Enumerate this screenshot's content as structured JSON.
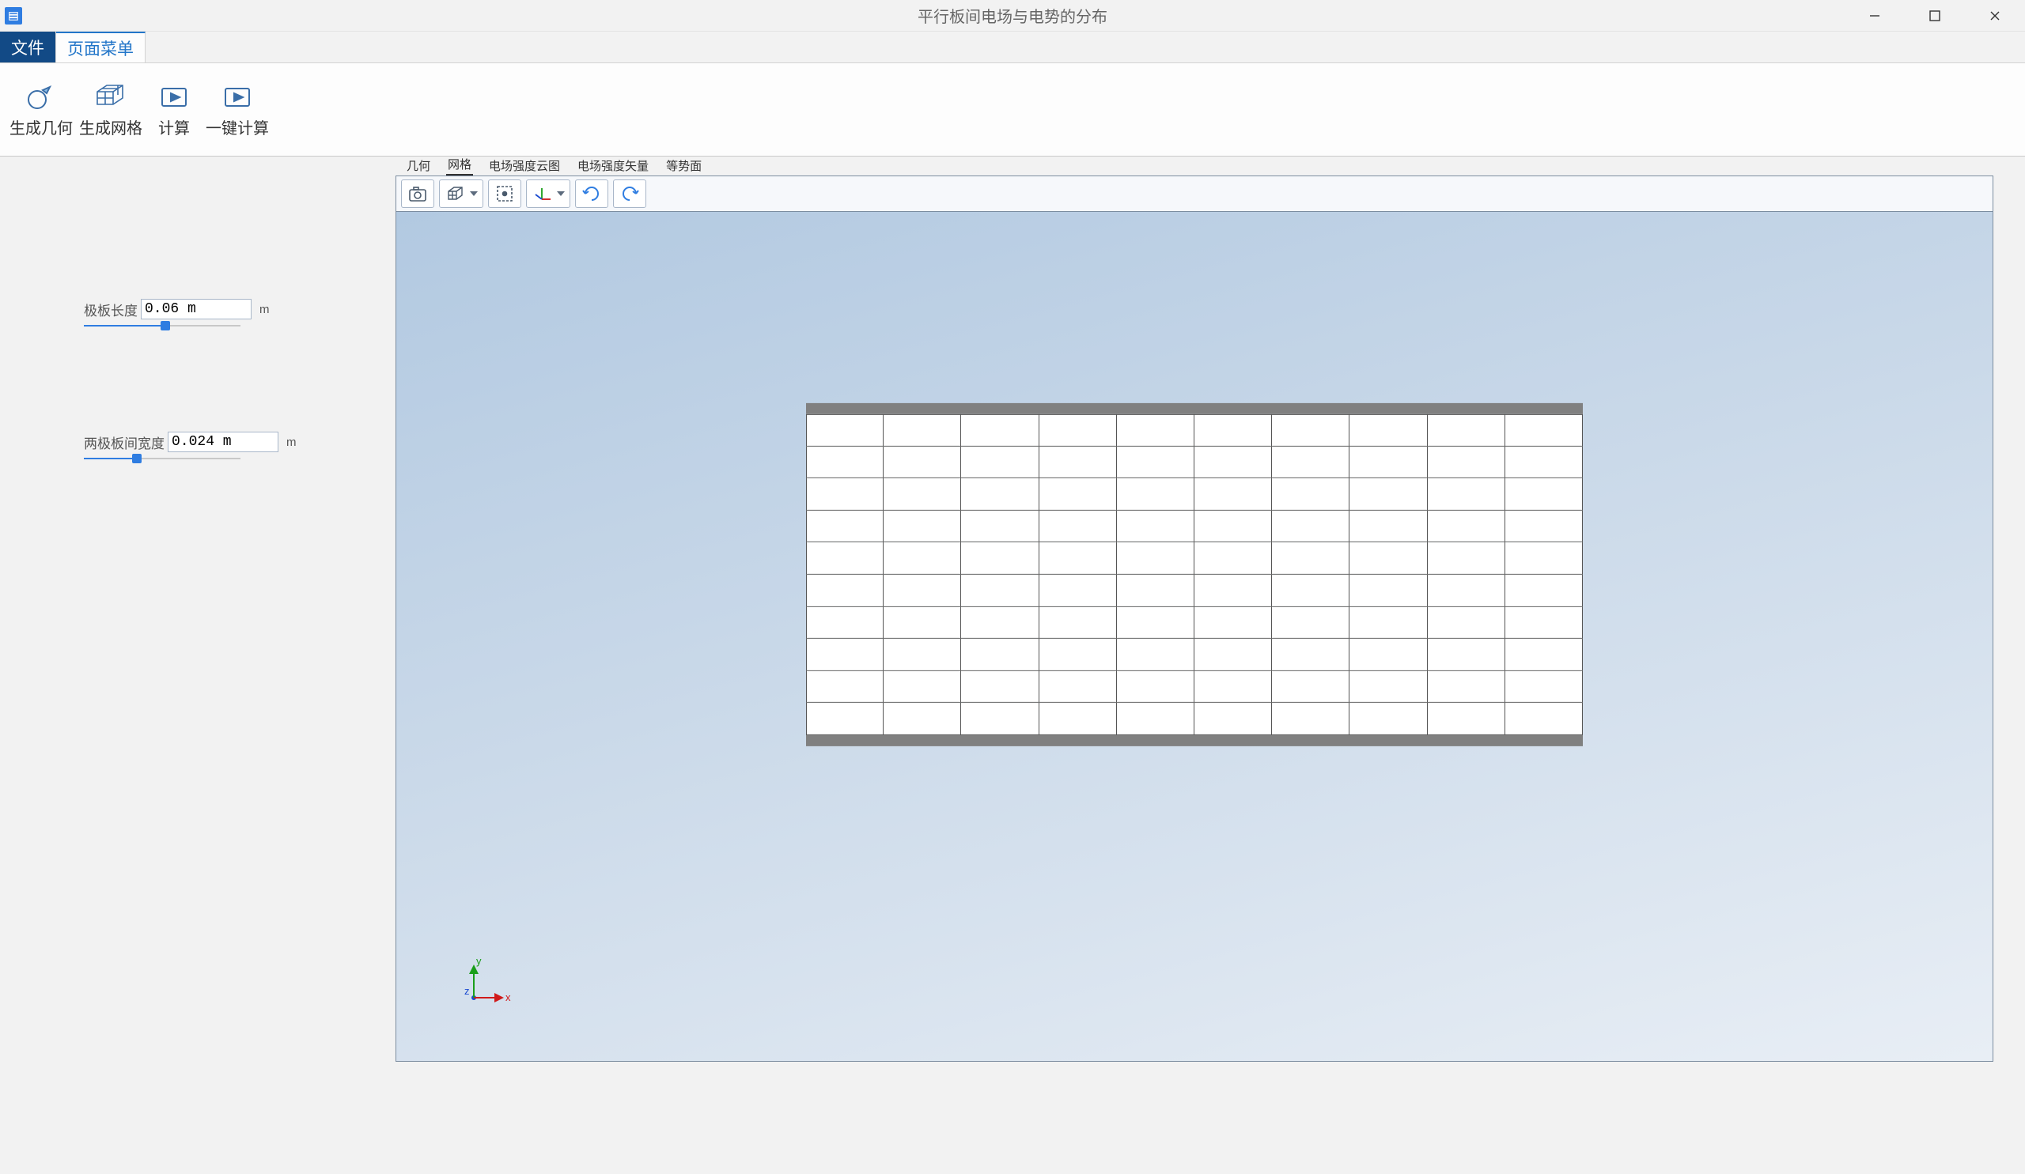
{
  "window": {
    "title": "平行板间电场与电势的分布"
  },
  "menu": {
    "tabs": [
      "文件",
      "页面菜单"
    ],
    "active_index": 1
  },
  "ribbon": {
    "buttons": [
      {
        "label": "生成几何",
        "icon": "generate-geometry-icon"
      },
      {
        "label": "生成网格",
        "icon": "generate-mesh-icon"
      },
      {
        "label": "计算",
        "icon": "compute-icon"
      },
      {
        "label": "一键计算",
        "icon": "compute-all-icon"
      }
    ]
  },
  "params": {
    "plate_length": {
      "label": "极板长度",
      "value": "0.06 m",
      "unit": "m",
      "slider_pct": 52
    },
    "plate_gap": {
      "label": "两极板间宽度",
      "value": "0.024 m",
      "unit": "m",
      "slider_pct": 34
    }
  },
  "view_tabs": [
    "几何",
    "网格",
    "电场强度云图",
    "电场强度矢量",
    "等势面"
  ],
  "view_active_index": 1,
  "triad": {
    "x": "x",
    "y": "y",
    "z": "z"
  }
}
